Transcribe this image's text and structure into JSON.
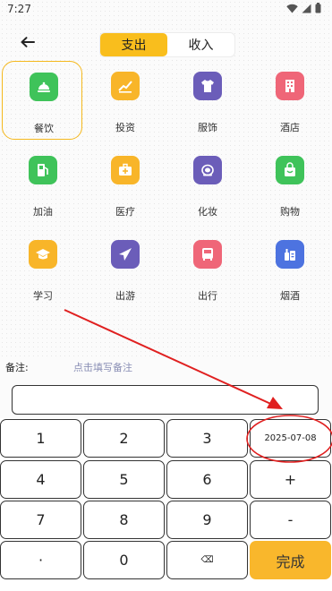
{
  "status_bar": {
    "time": "7:27"
  },
  "tabs": [
    {
      "label": "支出",
      "active": true
    },
    {
      "label": "收入",
      "active": false
    }
  ],
  "categories": [
    {
      "label": "餐饮",
      "icon": "food-cover-icon",
      "color": "#3fc35a",
      "selected": true
    },
    {
      "label": "投资",
      "icon": "investment-chart-icon",
      "color": "#f8b529"
    },
    {
      "label": "服饰",
      "icon": "tshirt-icon",
      "color": "#6b5db9"
    },
    {
      "label": "酒店",
      "icon": "hotel-building-icon",
      "color": "#ef6678"
    },
    {
      "label": "加油",
      "icon": "fuel-pump-icon",
      "color": "#3fc35a"
    },
    {
      "label": "医疗",
      "icon": "medical-kit-icon",
      "color": "#f8b529"
    },
    {
      "label": "化妆",
      "icon": "cosmetics-icon",
      "color": "#6b5db9"
    },
    {
      "label": "购物",
      "icon": "shopping-bag-icon",
      "color": "#3fc35a"
    },
    {
      "label": "学习",
      "icon": "graduation-cap-icon",
      "color": "#f8b529"
    },
    {
      "label": "出游",
      "icon": "airplane-icon",
      "color": "#6b5db9"
    },
    {
      "label": "出行",
      "icon": "bus-icon",
      "color": "#ef6678"
    },
    {
      "label": "烟酒",
      "icon": "tobacco-wine-icon",
      "color": "#4d73e0"
    }
  ],
  "memo": {
    "label": "备注:",
    "hint": "点击填写备注",
    "value": ""
  },
  "keypad": {
    "keys": [
      "1",
      "2",
      "3",
      "2025-07-08",
      "4",
      "5",
      "6",
      "+",
      "7",
      "8",
      "9",
      "-",
      "·",
      "0",
      "⌫",
      "完成"
    ]
  },
  "colors": {
    "accent": "#f9be1d",
    "done": "#f9b72c",
    "annotation": "#e02020"
  }
}
